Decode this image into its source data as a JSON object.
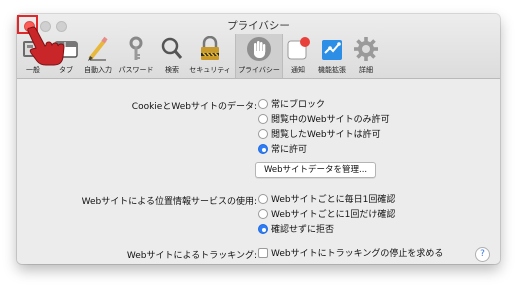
{
  "window": {
    "title": "プライバシー"
  },
  "tabs": [
    {
      "label": "一般",
      "icon": "general-icon"
    },
    {
      "label": "タブ",
      "icon": "tabs-icon"
    },
    {
      "label": "自動入力",
      "icon": "autofill-pencil-icon"
    },
    {
      "label": "パスワード",
      "icon": "key-icon"
    },
    {
      "label": "検索",
      "icon": "magnifier-icon"
    },
    {
      "label": "セキュリティ",
      "icon": "padlock-icon"
    },
    {
      "label": "プライバシー",
      "icon": "hand-icon",
      "active": true
    },
    {
      "label": "通知",
      "icon": "notification-icon"
    },
    {
      "label": "機能拡張",
      "icon": "puzzle-icon"
    },
    {
      "label": "詳細",
      "icon": "gear-icon"
    }
  ],
  "cookies": {
    "label": "CookieとWebサイトのデータ:",
    "options": [
      "常にブロック",
      "閲覧中のWebサイトのみ許可",
      "閲覧したWebサイトは許可",
      "常に許可"
    ],
    "selected_index": 3,
    "manage_button": "Webサイトデータを管理..."
  },
  "location": {
    "label": "Webサイトによる位置情報サービスの使用:",
    "options": [
      "Webサイトごとに毎日1回確認",
      "Webサイトごとに1回だけ確認",
      "確認せずに拒否"
    ],
    "selected_index": 2
  },
  "tracking": {
    "label": "Webサイトによるトラッキング:",
    "checkbox_label": "Webサイトにトラッキングの停止を求める",
    "checked": false
  },
  "help": {
    "symbol": "?"
  },
  "colors": {
    "accent": "#2f7df6",
    "highlight_box": "#e0282b",
    "close": "#fc5b57"
  }
}
